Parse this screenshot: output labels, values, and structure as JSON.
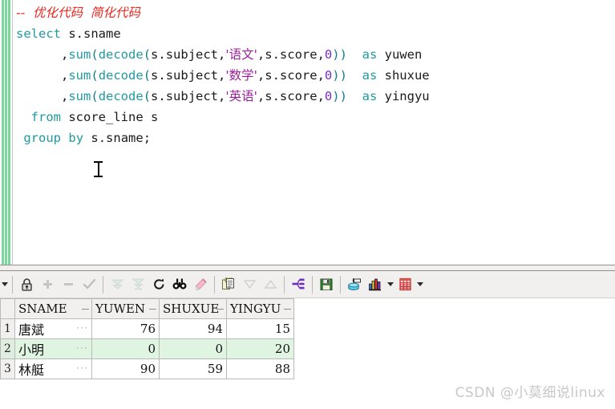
{
  "editor": {
    "gutter_marker_color": "#7ad89a",
    "lines": [
      {
        "id": "line-comment",
        "type": "comment",
        "text": "--  优化代码  简化代码"
      },
      {
        "id": "line-select",
        "type": "code",
        "text": "select s.sname"
      },
      {
        "id": "line-sum-yuwen",
        "type": "code",
        "text": "       , sum(decode(s.subject,'语文',s.score,0)) as yuwen"
      },
      {
        "id": "line-sum-shuxue",
        "type": "code",
        "text": "       , sum(decode(s.subject,'数学',s.score,0)) as shuxue"
      },
      {
        "id": "line-sum-yingyu",
        "type": "code",
        "text": "       , sum(decode(s.subject,'英语',s.score,0)) as yingyu"
      },
      {
        "id": "line-from",
        "type": "code",
        "text": "  from score_line s"
      },
      {
        "id": "line-groupby",
        "type": "code",
        "text": " group by s.sname;"
      }
    ],
    "tokens": {
      "comment_dashes": "--",
      "comment_text_1": "优化代码",
      "comment_text_2": "简化代码",
      "kw_select": "select",
      "kw_sum": "sum",
      "fn_decode": "decode",
      "kw_as": "as",
      "kw_from": "from",
      "kw_group": "group",
      "kw_by": "by",
      "col_sname": "s.sname",
      "col_subject": "s.subject",
      "col_score": "s.score",
      "literal_yuwen": "'语文'",
      "literal_shuxue": "'数学'",
      "literal_yingyu": "'英语'",
      "zero": "0",
      "alias_yuwen": "yuwen",
      "alias_shuxue": "shuxue",
      "alias_yingyu": "yingyu",
      "table_name": "score_line",
      "table_alias": "s",
      "semicolon": ";",
      "comma": ",",
      "open_paren": "(",
      "close_paren": ")"
    },
    "colors": {
      "comment": "#e8281e",
      "keyword": "#1f9aa0",
      "string": "#9b1f9b",
      "number": "#7b2fbe",
      "identifier": "#1a1a1a"
    }
  },
  "toolbar": {
    "items": [
      {
        "name": "mode-dropdown-caret",
        "icon": "caret-down-icon",
        "label": "",
        "enabled": true
      },
      {
        "name": "lock-record-button",
        "icon": "lock-icon",
        "label": "",
        "enabled": true
      },
      {
        "name": "insert-row-button",
        "icon": "plus-icon",
        "label": "",
        "enabled": false
      },
      {
        "name": "delete-row-button",
        "icon": "minus-icon",
        "label": "",
        "enabled": false
      },
      {
        "name": "post-changes-button",
        "icon": "check-icon",
        "label": "",
        "enabled": false
      },
      {
        "name": "fetch-next-page-button",
        "icon": "double-chevron-down-icon",
        "label": "",
        "enabled": false
      },
      {
        "name": "fetch-last-page-button",
        "icon": "chevron-down-bar-icon",
        "label": "",
        "enabled": false
      },
      {
        "name": "refresh-button",
        "icon": "refresh-icon",
        "label": "",
        "enabled": true
      },
      {
        "name": "find-button",
        "icon": "binoculars-icon",
        "label": "",
        "enabled": true
      },
      {
        "name": "highlight-button",
        "icon": "marker-pen-icon",
        "label": "",
        "enabled": true
      },
      {
        "name": "copy-grid-button",
        "icon": "copy-pages-icon",
        "label": "",
        "enabled": true
      },
      {
        "name": "sort-descending-button",
        "icon": "triangle-down-icon",
        "label": "",
        "enabled": false
      },
      {
        "name": "sort-ascending-button",
        "icon": "triangle-up-icon",
        "label": "",
        "enabled": false
      },
      {
        "name": "explain-plan-button",
        "icon": "node-tree-icon",
        "label": "",
        "enabled": true
      },
      {
        "name": "save-results-button",
        "icon": "floppy-disk-icon",
        "label": "",
        "enabled": true
      },
      {
        "name": "export-data-button",
        "icon": "database-export-icon",
        "label": "",
        "enabled": true
      },
      {
        "name": "chart-button",
        "icon": "bar-chart-icon",
        "label": "",
        "enabled": true
      },
      {
        "name": "chart-dropdown-caret",
        "icon": "caret-down-icon",
        "label": "",
        "enabled": true
      },
      {
        "name": "grid-view-button",
        "icon": "red-grid-icon",
        "label": "",
        "enabled": true
      },
      {
        "name": "grid-view-dropdown-caret",
        "icon": "caret-down-icon",
        "label": "",
        "enabled": true
      }
    ]
  },
  "results": {
    "columns": [
      "SNAME",
      "YUWEN",
      "SHUXUE",
      "YINGYU"
    ],
    "rows": [
      {
        "num": "1",
        "SNAME": "唐斌",
        "YUWEN": "76",
        "SHUXUE": "94",
        "YINGYU": "15",
        "selected": false
      },
      {
        "num": "2",
        "SNAME": "小明",
        "YUWEN": "0",
        "SHUXUE": "0",
        "YINGYU": "20",
        "selected": true
      },
      {
        "num": "3",
        "SNAME": "林艇",
        "YUWEN": "90",
        "SHUXUE": "59",
        "YINGYU": "88",
        "selected": false
      }
    ],
    "selected_row_color": "#e0f4e2",
    "cell_overflow_marker": "···"
  },
  "watermark": {
    "text": "CSDN @小莫细说linux",
    "color": "#c8c8c8"
  }
}
